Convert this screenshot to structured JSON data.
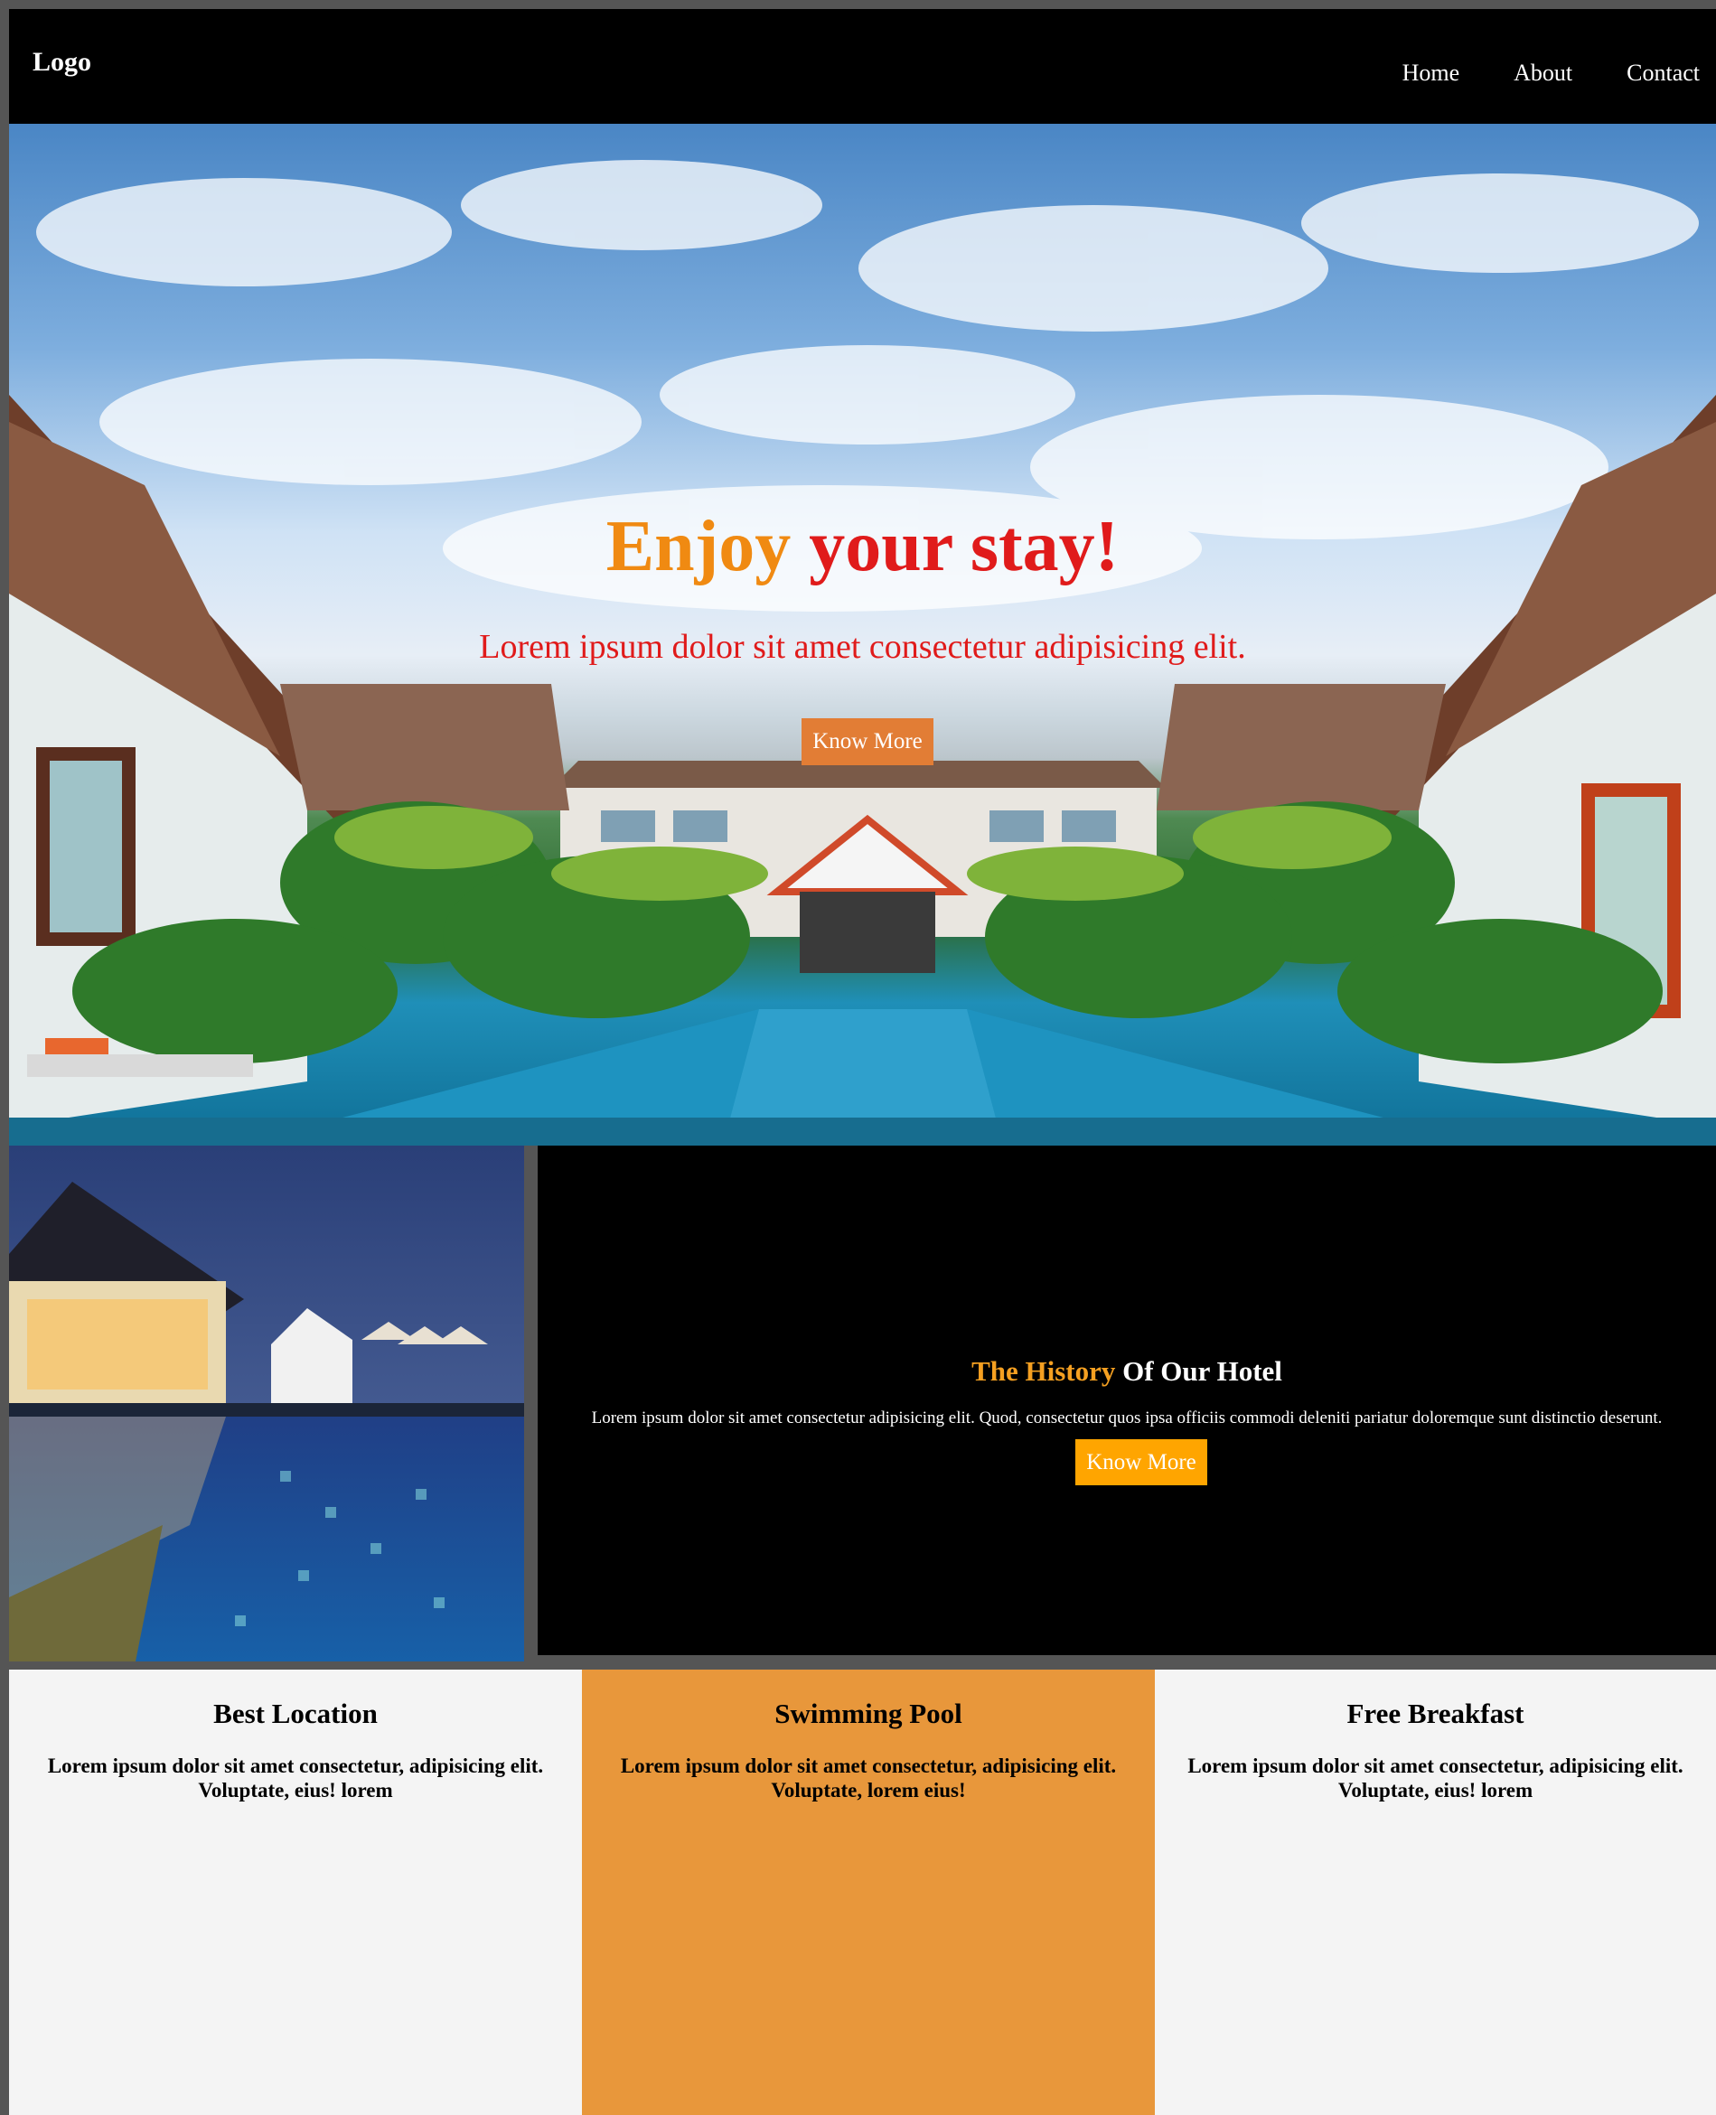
{
  "header": {
    "logo": "Logo",
    "nav": [
      {
        "label": "Home"
      },
      {
        "label": "About"
      },
      {
        "label": "Contact"
      }
    ]
  },
  "hero": {
    "title_part1": "Enjoy",
    "title_part2": "your stay!",
    "subtitle": "Lorem ipsum dolor sit amet consectetur adipisicing elit.",
    "button": "Know More"
  },
  "history": {
    "title_part1": "The History",
    "title_part2": "Of Our Hotel",
    "text": "Lorem ipsum dolor sit amet consectetur adipisicing elit. Quod, consectetur quos ipsa officiis commodi deleniti pariatur doloremque sunt distinctio deserunt.",
    "button": "Know More"
  },
  "features": [
    {
      "title": "Best Location",
      "text": "Lorem ipsum dolor sit amet consectetur, adipisicing elit. Voluptate, eius! lorem"
    },
    {
      "title": "Swimming Pool",
      "text": "Lorem ipsum dolor sit amet consectetur, adipisicing elit. Voluptate, lorem eius!"
    },
    {
      "title": "Free Breakfast",
      "text": "Lorem ipsum dolor sit amet consectetur, adipisicing elit. Voluptate, eius! lorem"
    }
  ],
  "colors": {
    "hero_title_accent": "#f08a12",
    "hero_title_main": "#e01b1b",
    "hero_button": "#e27d35",
    "history_button": "#ffa500",
    "feature_accent": "#e8973b"
  }
}
